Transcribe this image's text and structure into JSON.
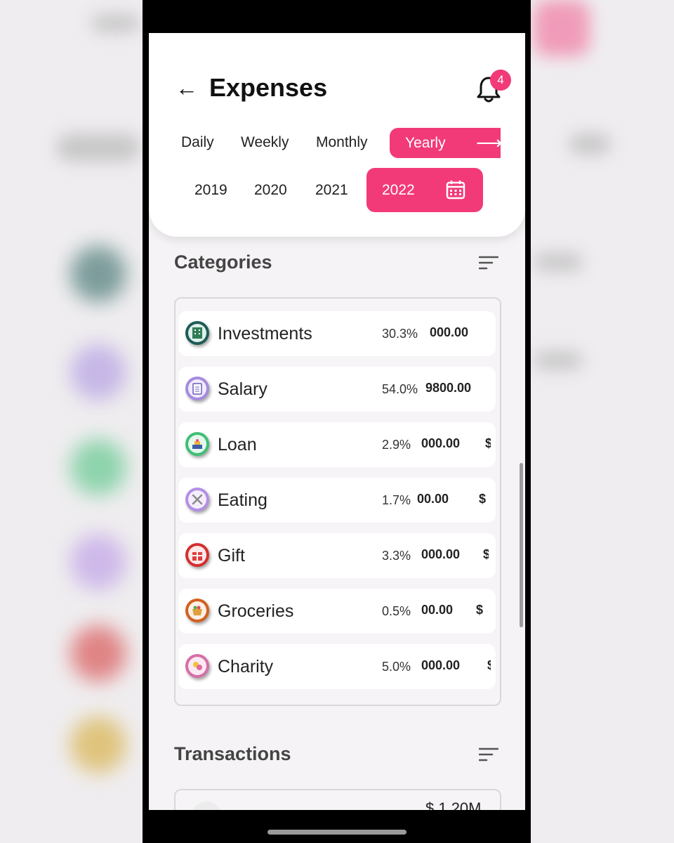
{
  "header": {
    "back_symbol": "←",
    "title": "Expenses",
    "notification_count": "4"
  },
  "period_tabs": [
    {
      "label": "Daily"
    },
    {
      "label": "Weekly"
    },
    {
      "label": "Monthly"
    },
    {
      "label": "Yearly",
      "selected": true
    }
  ],
  "period_active_arrow": "⟶",
  "years": [
    {
      "label": "2019"
    },
    {
      "label": "2020"
    },
    {
      "label": "2021"
    },
    {
      "label": "2022",
      "selected": true
    }
  ],
  "categories_section": {
    "title": "Categories",
    "items": [
      {
        "name": "Investments",
        "percent": "30.3%",
        "amount": "000.00",
        "currency": "",
        "icon": "building-icon",
        "color": "#1f5b57"
      },
      {
        "name": "Salary",
        "percent": "54.0%",
        "amount": "9800.00",
        "currency": "",
        "icon": "notepad-icon",
        "color": "#a58be0"
      },
      {
        "name": "Loan",
        "percent": "2.9%",
        "amount": "000.00",
        "currency": "$",
        "icon": "bank-icon",
        "color": "#3fbf76"
      },
      {
        "name": "Eating",
        "percent": "1.7%",
        "amount": "00.00",
        "currency": "$",
        "icon": "fork-knife-icon",
        "color": "#b48ee6"
      },
      {
        "name": "Gift",
        "percent": "3.3%",
        "amount": "000.00",
        "currency": "$",
        "icon": "gift-icon",
        "color": "#d42f2f"
      },
      {
        "name": "Groceries",
        "percent": "0.5%",
        "amount": "00.00",
        "currency": "$",
        "icon": "basket-icon",
        "color": "#d2611f"
      },
      {
        "name": "Charity",
        "percent": "5.0%",
        "amount": "000.00",
        "currency": "$",
        "icon": "charity-icon",
        "color": "#d66fa8"
      }
    ]
  },
  "transactions_section": {
    "title": "Transactions",
    "first_amount": "$ 1.20M"
  },
  "colors": {
    "accent": "#f23a78",
    "background": "#f5f3f5",
    "text": "#222222"
  }
}
